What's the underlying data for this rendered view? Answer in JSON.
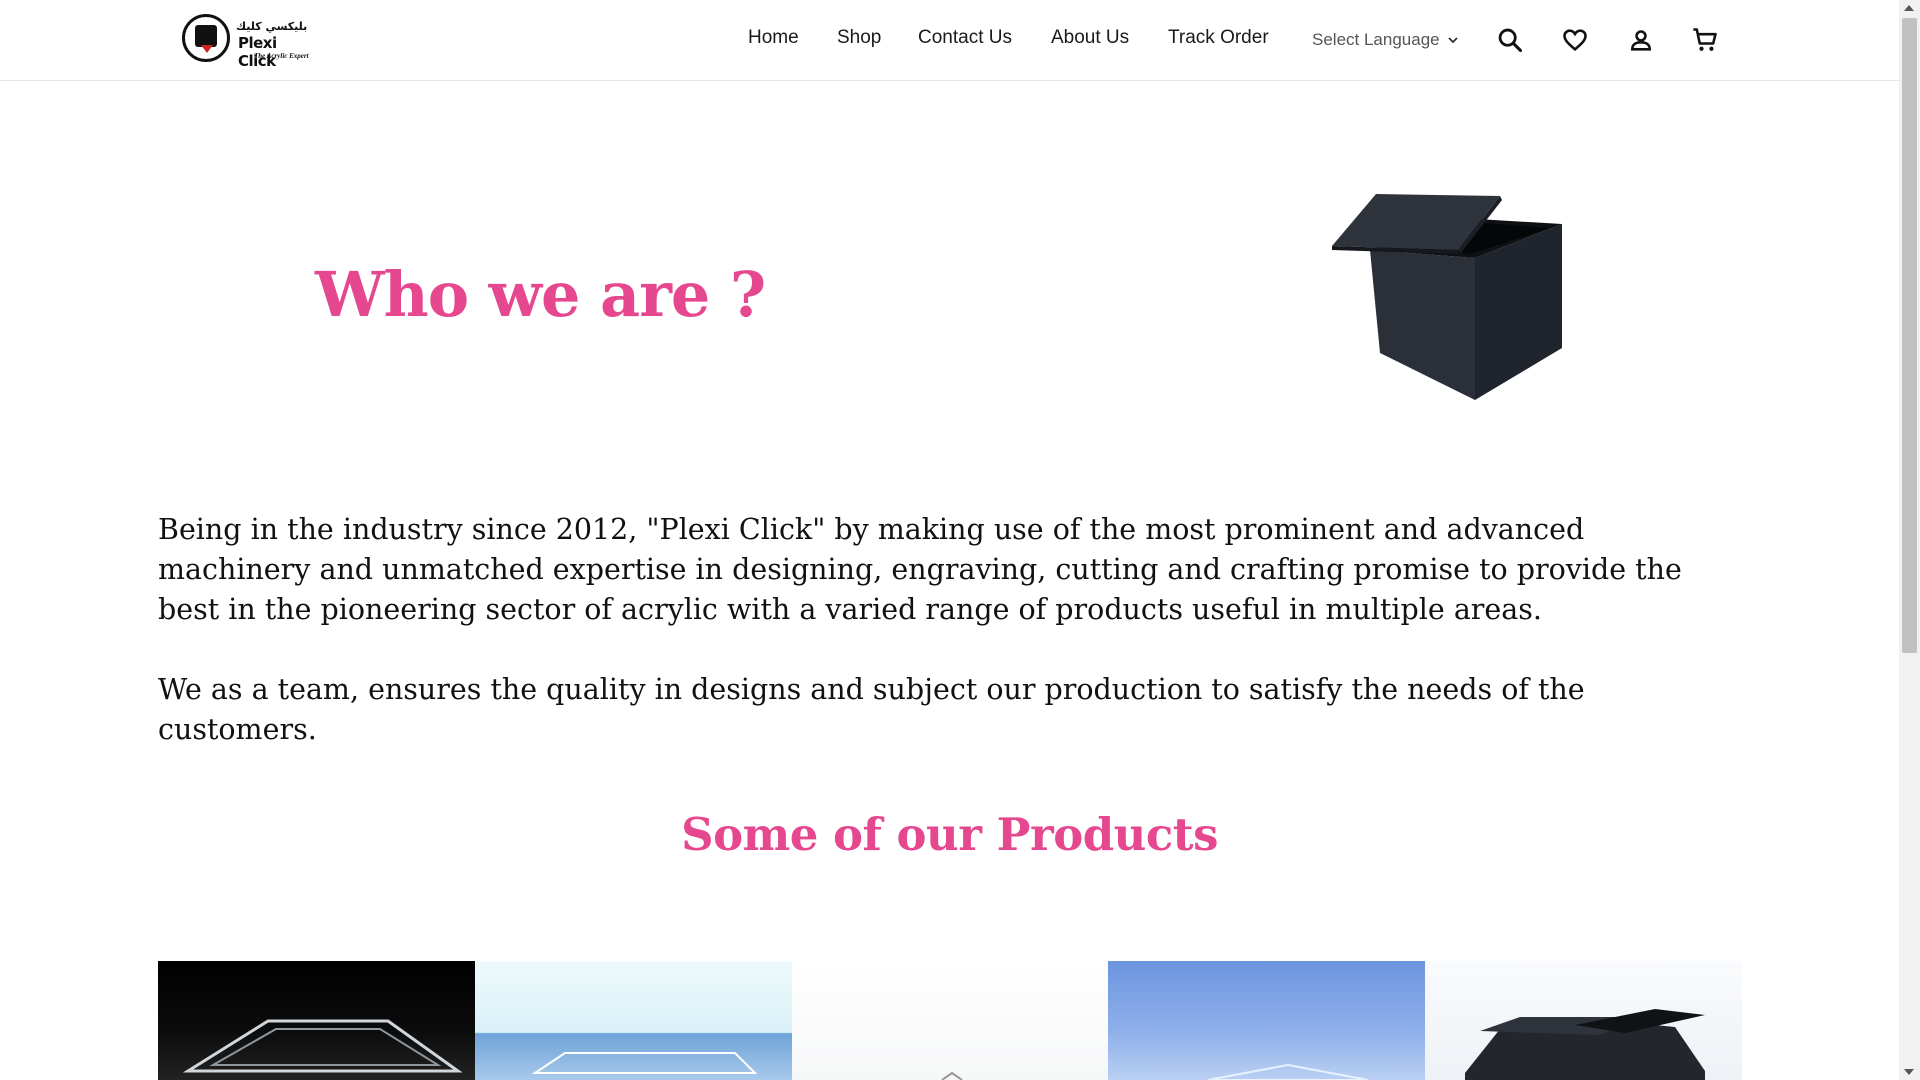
{
  "header": {
    "logo": {
      "arabic": "بليكسي كليك",
      "name": "Plexi Click",
      "tagline": "The Acrylic Expert"
    },
    "nav": [
      {
        "label": "Home"
      },
      {
        "label": "Shop"
      },
      {
        "label": "Contact Us"
      },
      {
        "label": "About Us"
      },
      {
        "label": "Track Order"
      }
    ],
    "language": {
      "label": "Select Language"
    },
    "icons": [
      "search-icon",
      "heart-icon",
      "user-icon",
      "cart-icon"
    ]
  },
  "hero": {
    "title": "Who we are ?"
  },
  "about": {
    "paragraphs": [
      "Being in the industry since 2012, \"Plexi Click\" by making use of the most prominent and advanced machinery and unmatched expertise in designing, engraving, cutting and crafting promise to provide the best in the pioneering sector of acrylic with a varied range of products useful in multiple areas.",
      "We as a team, ensures the quality in designs and subject our production to satisfy the needs of the customers."
    ]
  },
  "products": {
    "title": "Some of our Products"
  },
  "colors": {
    "accent": "#e5488f",
    "text": "#111111"
  }
}
